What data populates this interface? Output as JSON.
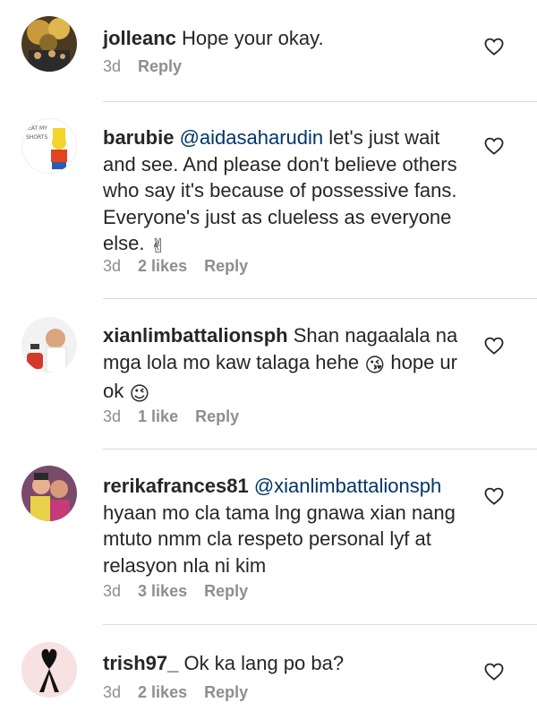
{
  "comments": [
    {
      "username": "jolleanc",
      "text": "Hope your okay.",
      "time": "3d",
      "likes": "",
      "reply": "Reply",
      "avatar_icon": "user-avatar-photo"
    },
    {
      "username": "barubie",
      "mention": "@aidasaharudin",
      "text": "let's just wait and see. And please don't believe others who say it's because of possessive fans. Everyone's just as clueless as everyone else.",
      "emoji": "✌",
      "time": "3d",
      "likes": "2 likes",
      "reply": "Reply",
      "avatar_icon": "cartoon-avatar",
      "avatar_text": "EAT MY SHORTS"
    },
    {
      "username": "xianlimbattalionsph",
      "text_a": "Shan nagaalala na mga lola mo kaw talaga hehe",
      "emoji_a": "😘",
      "text_b": "hope ur ok",
      "emoji_b": "😉",
      "time": "3d",
      "likes": "1 like",
      "reply": "Reply",
      "avatar_icon": "user-avatar-photo"
    },
    {
      "username": "rerikafrances81",
      "mention": "@xianlimbattalionsph",
      "text": "hyaan mo cla tama lng gnawa xian nang mtuto nmm cla respeto personal lyf at relasyon nla ni kim",
      "time": "3d",
      "likes": "3 likes",
      "reply": "Reply",
      "avatar_icon": "user-avatar-photo"
    },
    {
      "username": "trish97_",
      "text": "Ok ka lang po ba?",
      "time": "3d",
      "likes": "2 likes",
      "reply": "Reply",
      "avatar_icon": "ribbon-avatar"
    }
  ],
  "colors": {
    "text": "#262626",
    "meta": "#8e8e8e",
    "mention": "#003569",
    "divider": "#dbdbdb",
    "heart": "#262626"
  }
}
